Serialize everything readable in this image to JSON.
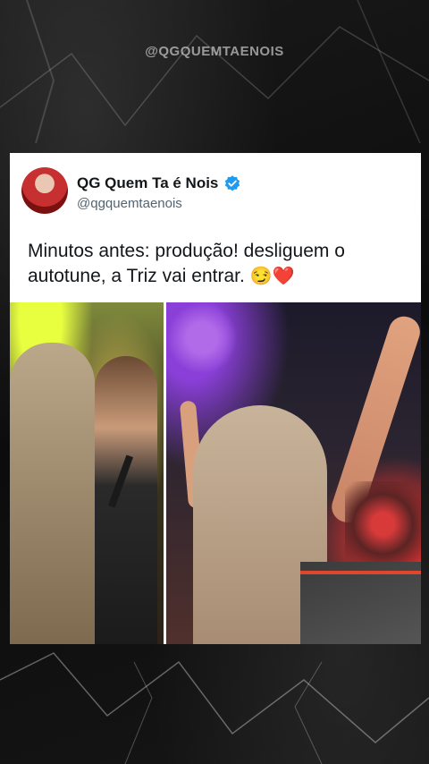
{
  "watermark": "@QGQUEMTAENOIS",
  "tweet": {
    "author_name": "QG Quem Ta é Nois",
    "handle": "@qgquemtaenois",
    "text": "Minutos antes: produção! desliguem o autotune, a Triz vai entrar.",
    "emojis": "😏❤️",
    "verified_icon": "verified-badge-icon",
    "verified_color": "#1d9bf0"
  },
  "media": {
    "left_image": "photo of two women on stage, one holding a microphone",
    "right_image": "photo of performer with raised arm facing concert crowd"
  }
}
